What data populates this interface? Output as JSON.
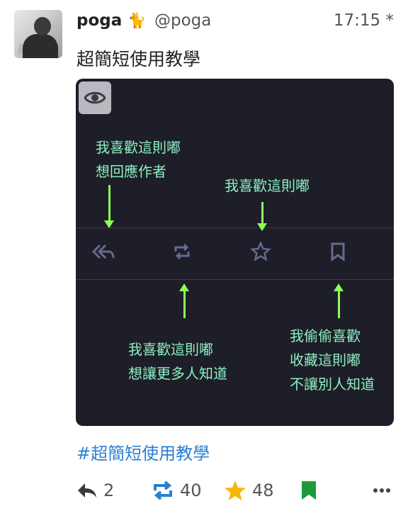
{
  "post": {
    "display_name": "poga",
    "name_emoji": "🐈",
    "handle": "@poga",
    "time": "17:15 *",
    "text": "超簡短使用教學",
    "hashtag": "#超簡短使用教學"
  },
  "media": {
    "notes": {
      "reply": [
        "我喜歡這則嘟",
        "想回應作者"
      ],
      "favourite": [
        "我喜歡這則嘟"
      ],
      "boost": [
        "我喜歡這則嘟",
        "想讓更多人知道"
      ],
      "bookmark": [
        "我偷偷喜歡",
        "收藏這則嘟",
        "不讓別人知道"
      ]
    },
    "icons": [
      "reply-icon",
      "boost-icon",
      "star-icon",
      "bookmark-icon"
    ],
    "note_color": "#8ef0c4",
    "arrow_color": "#8cff5a"
  },
  "actions": {
    "reply_count": "2",
    "boost_count": "40",
    "favourite_count": "48",
    "icons": [
      "reply-icon",
      "boost-icon",
      "star-icon",
      "bookmark-icon",
      "more-icon"
    ],
    "boost_color": "#2b7fd1",
    "star_color": "#f5b800",
    "bookmark_color": "#1e9a3c"
  }
}
